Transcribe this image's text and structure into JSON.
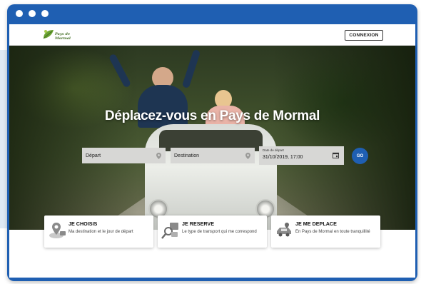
{
  "header": {
    "logo_text": "Pays de Mormal",
    "login_label": "CONNEXION"
  },
  "hero": {
    "title": "Déplacez-vous en Pays de Mormal"
  },
  "search": {
    "departure_placeholder": "Départ",
    "destination_placeholder": "Destination",
    "date_caption": "Date de départ",
    "date_value": "31/10/2019, 17:00",
    "go_label": "GO"
  },
  "steps": [
    {
      "title": "JE CHOISIS",
      "text": "Ma destination et le jour de départ",
      "icon": "map-pin-icon"
    },
    {
      "title": "JE RESERVE",
      "text": "Le type de transport qui me correspond",
      "icon": "search-transport-icon"
    },
    {
      "title": "JE ME DEPLACE",
      "text": "En Pays de Mormal en toute tranquillité",
      "icon": "car-icon"
    }
  ],
  "colors": {
    "frame": "#1f5fb2",
    "go_button": "#1f5fb2",
    "field_bg": "#d7d7d5"
  }
}
